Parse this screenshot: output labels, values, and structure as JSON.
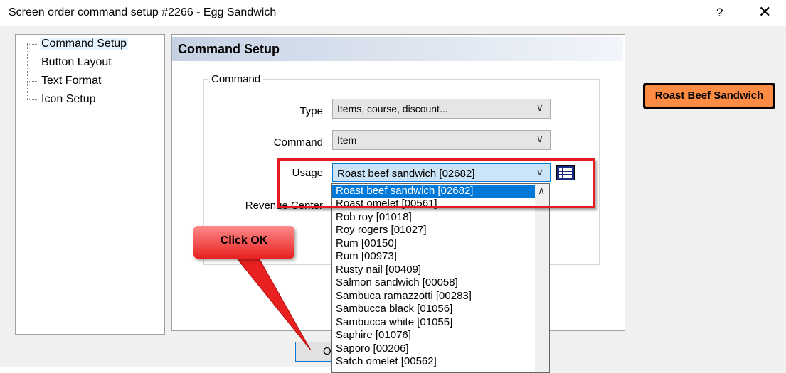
{
  "window": {
    "title": "Screen order command setup #2266 - Egg Sandwich",
    "help": "?",
    "close": "✕"
  },
  "tree": {
    "items": [
      {
        "label": "Command Setup"
      },
      {
        "label": "Button Layout"
      },
      {
        "label": "Text Format"
      },
      {
        "label": "Icon Setup"
      }
    ]
  },
  "panel": {
    "title": "Command Setup",
    "group_label": "Command",
    "type_label": "Type",
    "type_value": "Items, course, discount...",
    "command_label": "Command",
    "command_value": "Item",
    "usage_label": "Usage",
    "usage_value": "Roast beef sandwich [02682]",
    "revenue_label": "Revenue Center"
  },
  "dropdown": {
    "items": [
      "Roast beef sandwich [02682]",
      "Roast omelet [00561]",
      "Rob roy [01018]",
      "Roy rogers [01027]",
      "Rum [00150]",
      "Rum [00973]",
      "Rusty nail [00409]",
      "Salmon sandwich [00058]",
      "Sambuca ramazzotti [00283]",
      "Sambucca black [01056]",
      "Sambucca white [01055]",
      "Saphire [01076]",
      "Saporo [00206]",
      "Satch omelet [00562]"
    ]
  },
  "callout": {
    "text": "Click OK"
  },
  "ok_button": {
    "label": "O"
  },
  "preview": {
    "label": "Roast Beef Sandwich"
  },
  "colors": {
    "selection": "#0078d7",
    "highlight_box": "#e41b23",
    "preview_fill": "#ff8c42"
  },
  "icons": {
    "list_button": "list-icon"
  }
}
